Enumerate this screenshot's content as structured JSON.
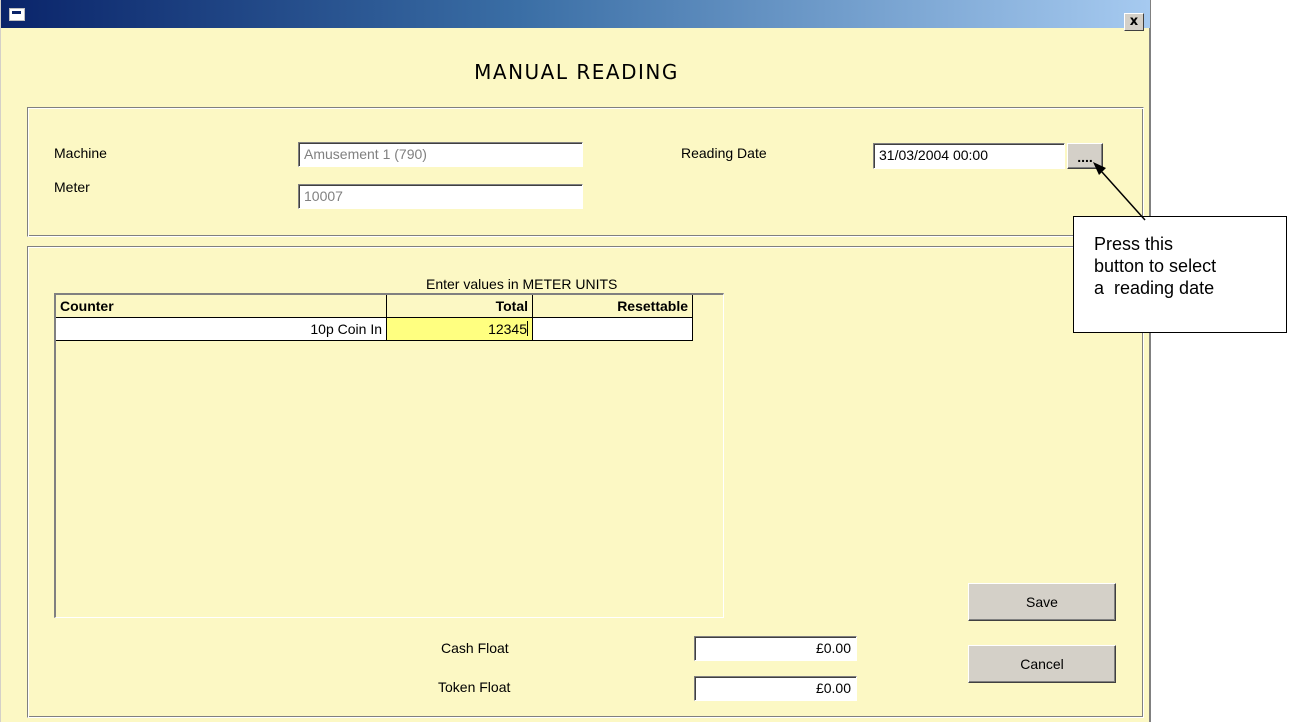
{
  "window": {
    "close_label": "x",
    "heading": "MANUAL READING"
  },
  "header": {
    "machine_label": "Machine",
    "machine_value": "Amusement 1 (790)",
    "meter_label": "Meter",
    "meter_value": "10007",
    "reading_date_label": "Reading Date",
    "reading_date_value": "31/03/2004 00:00",
    "date_picker_label": "...."
  },
  "grid": {
    "caption": "Enter values in METER UNITS",
    "columns": [
      "Counter",
      "Total",
      "Resettable"
    ],
    "rows": [
      {
        "counter": "10p Coin In",
        "total": "12345",
        "resettable": ""
      }
    ]
  },
  "floats": {
    "cash_label": "Cash Float",
    "cash_value": "£0.00",
    "token_label": "Token Float",
    "token_value": "£0.00"
  },
  "buttons": {
    "save": "Save",
    "cancel": "Cancel"
  },
  "callout": {
    "line1": "Press this",
    "line2": "button to select",
    "line3": "a  reading date"
  },
  "colors": {
    "form_background": "#fcf8c4",
    "titlebar_start": "#0a246a",
    "active_cell": "#ffff80"
  }
}
